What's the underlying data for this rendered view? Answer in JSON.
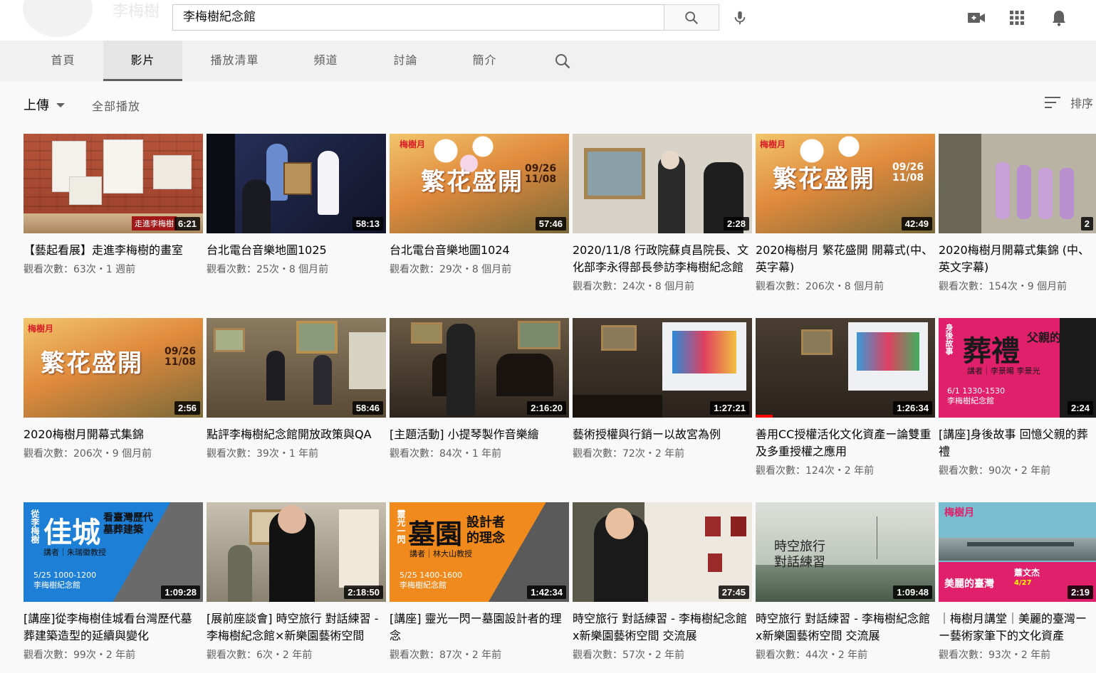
{
  "header": {
    "channel_name_ghost": "李梅樹",
    "search_value": "李梅樹紀念館",
    "icons": [
      "search-icon",
      "mic-icon",
      "video-camera-icon",
      "apps-grid-icon",
      "bell-icon"
    ]
  },
  "tabs": [
    {
      "label": "首頁",
      "active": false
    },
    {
      "label": "影片",
      "active": true
    },
    {
      "label": "播放清單",
      "active": false
    },
    {
      "label": "頻道",
      "active": false
    },
    {
      "label": "討論",
      "active": false
    },
    {
      "label": "簡介",
      "active": false
    }
  ],
  "filter": {
    "upload_label": "上傳",
    "playall_label": "全部播放",
    "sort_label": "排序"
  },
  "videos": [
    {
      "title": "【藝起看展】走進李梅樹的畫室",
      "meta": "觀看次數：63次・1 週前",
      "duration": "6:21",
      "overlay": "走進李梅樹",
      "bg": "#b5543a"
    },
    {
      "title": "台北電台音樂地圖1025",
      "meta": "觀看次數：25次・8 個月前",
      "duration": "58:13",
      "overlay": "",
      "bg": "#1f2440"
    },
    {
      "title": "台北電台音樂地圖1024",
      "meta": "觀看次數：29次・8 個月前",
      "duration": "57:46",
      "overlay": "",
      "bg": "#d27a3a"
    },
    {
      "title": "2020/11/8 行政院蘇貞昌院長、文化部李永得部長參訪李梅樹紀念館",
      "meta": "觀看次數：24次・8 個月前",
      "duration": "2:28",
      "overlay": "",
      "bg": "#c9c3b7"
    },
    {
      "title": "2020梅樹月 繁花盛開 開幕式(中、英字幕)",
      "meta": "觀看次數：206次・8 個月前",
      "duration": "42:49",
      "overlay": "",
      "bg": "#d27a3a"
    },
    {
      "title": "2020梅樹月開幕式集錦 (中、英文字幕)",
      "meta": "觀看次數：154次・9 個月前",
      "duration": "2",
      "overlay": "",
      "bg": "#8a8a7a"
    },
    {
      "title": "2020梅樹月開幕式集錦",
      "meta": "觀看次數：206次・9 個月前",
      "duration": "2:56",
      "overlay": "",
      "bg": "#d27a3a"
    },
    {
      "title": "點評李梅樹紀念館開放政策與QA",
      "meta": "觀看次數：39次・1 年前",
      "duration": "58:46",
      "overlay": "",
      "bg": "#6b5a44"
    },
    {
      "title": "[主題活動] 小提琴製作音樂繪",
      "meta": "觀看次數：84次・1 年前",
      "duration": "2:16:20",
      "overlay": "",
      "bg": "#4a3d30"
    },
    {
      "title": "藝術授權與行銷ー以故宮為例",
      "meta": "觀看次數：72次・2 年前",
      "duration": "1:27:21",
      "overlay": "",
      "bg": "#3a3028"
    },
    {
      "title": "善用CC授權活化文化資產ー論雙重及多重授權之應用",
      "meta": "觀看次數：124次・2 年前",
      "duration": "1:26:34",
      "overlay": "",
      "bg": "#3d342a"
    },
    {
      "title": "[講座]身後故事 回憶父親的葬禮",
      "meta": "觀看次數：90次・2 年前",
      "duration": "2:24",
      "overlay": "",
      "bg": "#e0206a"
    },
    {
      "title": "[講座]從李梅樹佳城看台灣歷代墓葬建築造型的延續與變化",
      "meta": "觀看次數：99次・2 年前",
      "duration": "1:09:28",
      "overlay": "",
      "bg": "#1e7fd6"
    },
    {
      "title": "[展前座談會] 時空旅行 對話練習 - 李梅樹紀念館×新樂園藝術空間",
      "meta": "觀看次數：6次・2 年前",
      "duration": "2:18:50",
      "overlay": "",
      "bg": "#6a6050"
    },
    {
      "title": "[講座] 靈光一閃ー墓園設計者的理念",
      "meta": "觀看次數：87次・2 年前",
      "duration": "1:42:34",
      "overlay": "",
      "bg": "#f08a1c"
    },
    {
      "title": "時空旅行 對話練習 - 李梅樹紀念館x新樂園藝術空間 交流展",
      "meta": "觀看次數：57次・2 年前",
      "duration": "27:45",
      "overlay": "",
      "bg": "#9a8f80"
    },
    {
      "title": "時空旅行 對話練習 - 李梅樹紀念館x新樂園藝術空間 交流展",
      "meta": "觀看次數：44次・2 年前",
      "duration": "1:09:48",
      "overlay": "",
      "bg": "#c8cfc6"
    },
    {
      "title": "｜梅樹月講堂｜美麗的臺灣ーー藝術家筆下的文化資產",
      "meta": "觀看次數：93次・2 年前",
      "duration": "2:19",
      "overlay": "",
      "bg": "#e0206a"
    }
  ],
  "thumb_text": {
    "v3": "繁花盛開",
    "v3b": "09/26\n11/08",
    "v3c": "梅樹月",
    "v12": "葬禮",
    "v12b": "父親的回憶",
    "v12c": "講者｜李景暘 李景光",
    "v12d": "6/1 1330-1530\n李梅樹紀念館",
    "v13": "佳城",
    "v13b": "看臺灣歷代墓葬建築",
    "v13c": "講者｜朱瑞徽教授",
    "v13d": "5/25 1000-1200\n李梅樹紀念館",
    "v15": "墓園",
    "v15b": "設計者的理念",
    "v15c": "講者｜林大山教授",
    "v15d": "5/25 1400-1600\n李梅樹紀念館",
    "v17": "時空旅行 對話練習",
    "v18": "美麗的臺灣",
    "v18b": "梅樹月",
    "v18c": "蕭文杰",
    "v18d": "4/27"
  }
}
